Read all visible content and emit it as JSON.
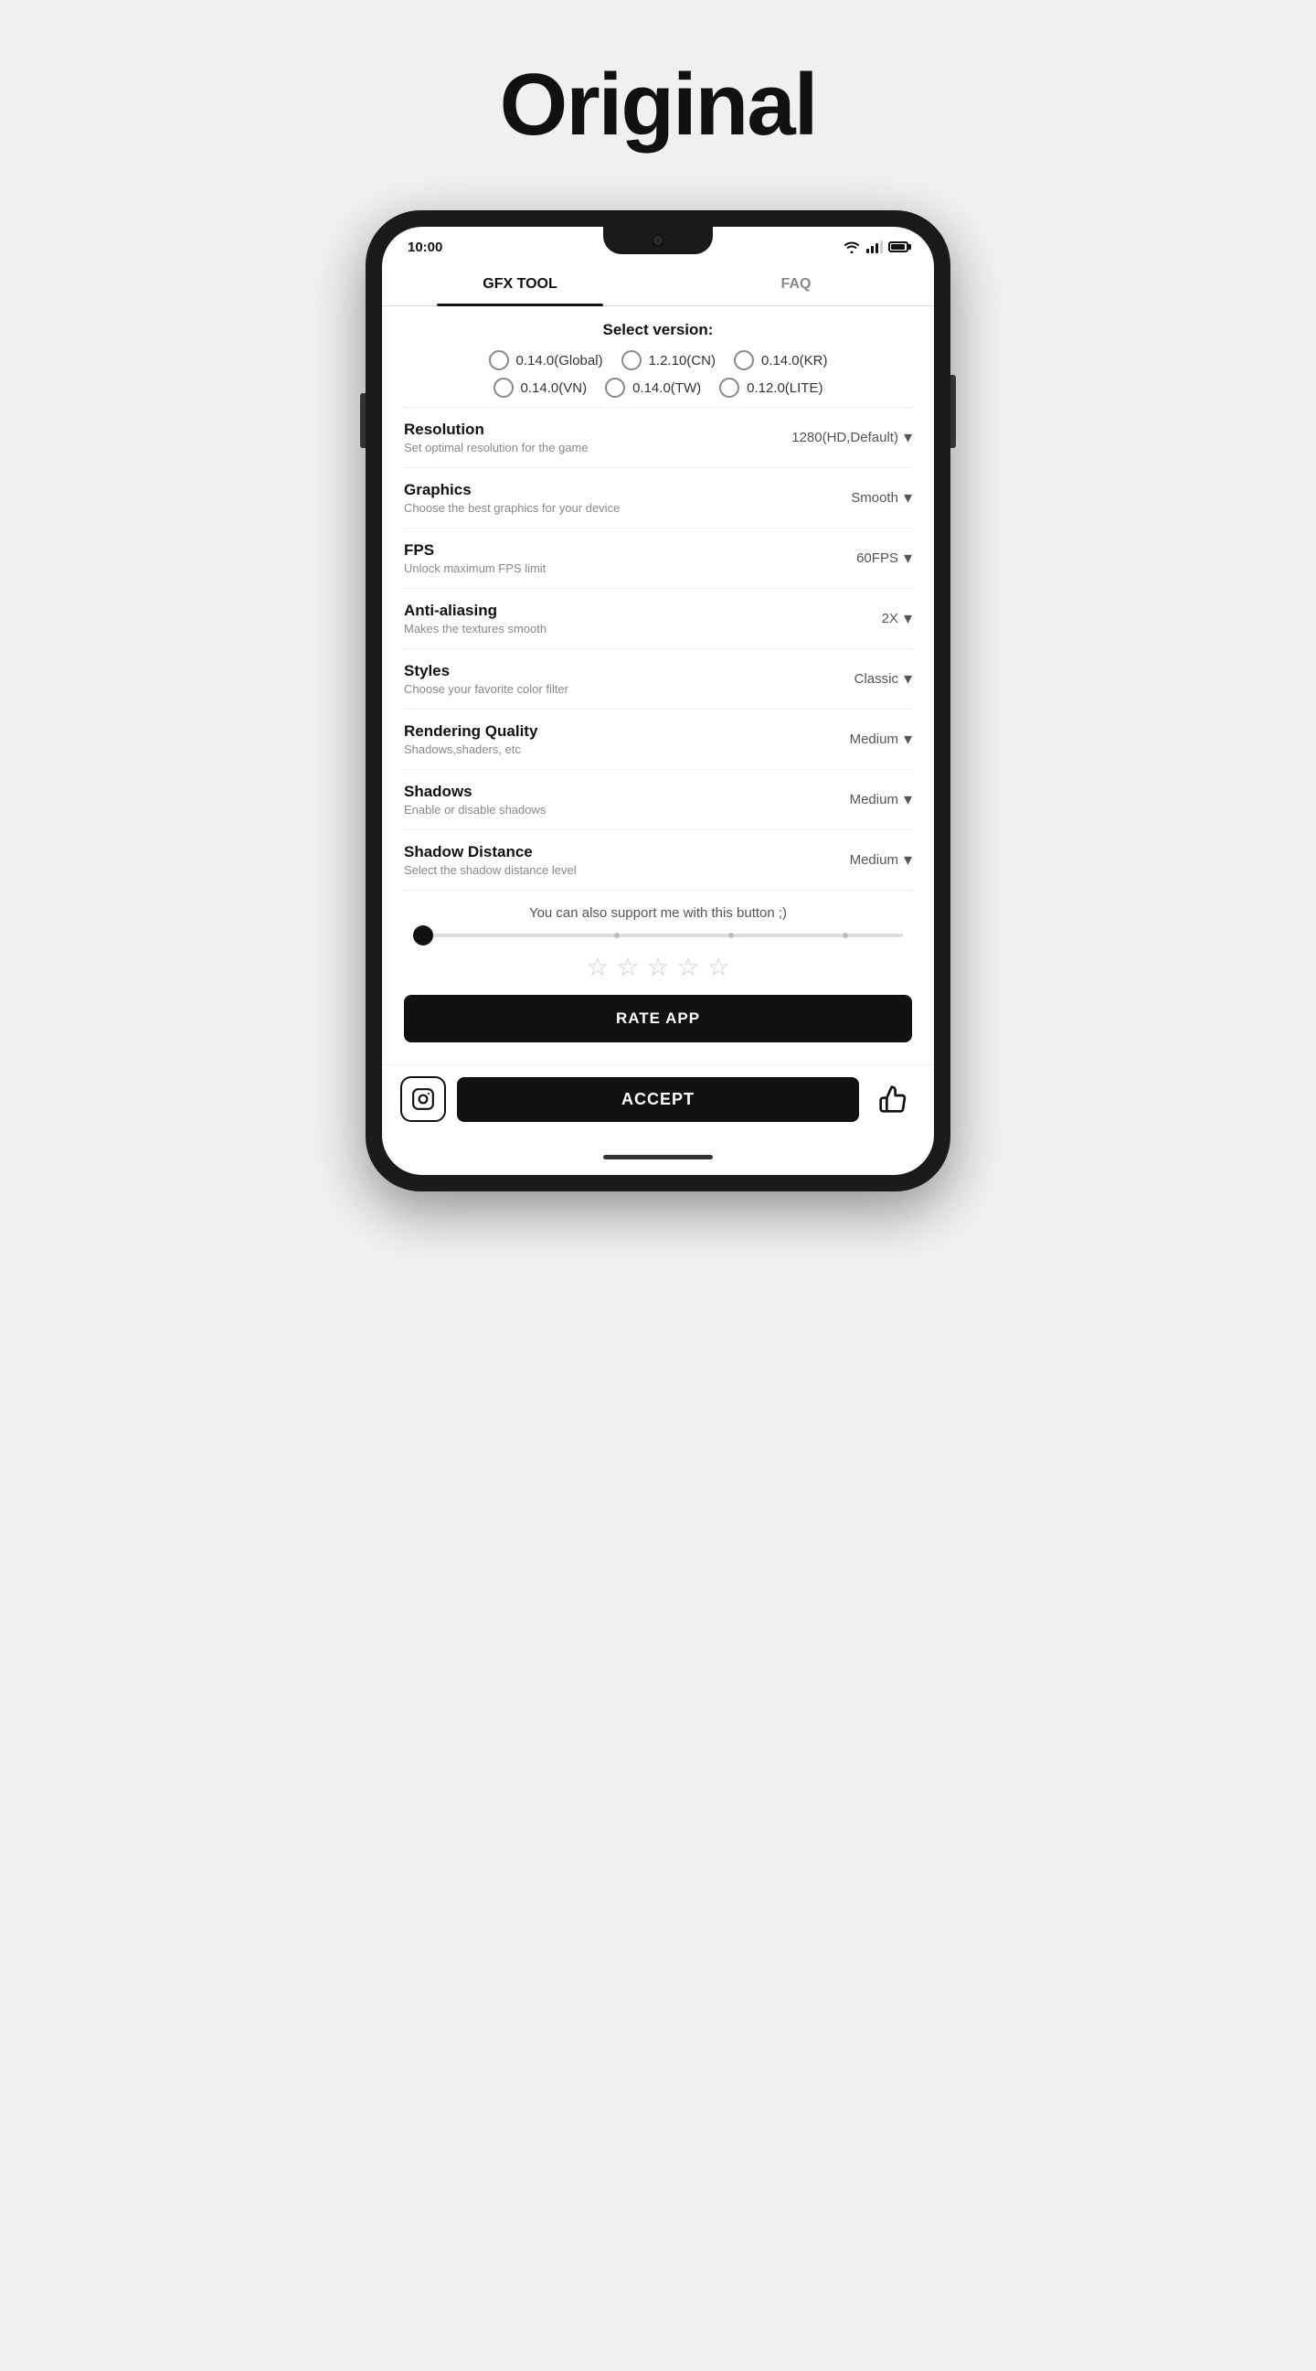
{
  "page": {
    "title": "Original"
  },
  "statusBar": {
    "time": "10:00"
  },
  "tabs": [
    {
      "id": "gfx-tool",
      "label": "GFX TOOL",
      "active": true
    },
    {
      "id": "faq",
      "label": "FAQ",
      "active": false
    }
  ],
  "versionSection": {
    "label": "Select version:",
    "options": [
      {
        "id": "global",
        "label": "0.14.0(Global)"
      },
      {
        "id": "cn",
        "label": "1.2.10(CN)"
      },
      {
        "id": "kr",
        "label": "0.14.0(KR)"
      },
      {
        "id": "vn",
        "label": "0.14.0(VN)"
      },
      {
        "id": "tw",
        "label": "0.14.0(TW)"
      },
      {
        "id": "lite",
        "label": "0.12.0(LITE)"
      }
    ]
  },
  "settings": [
    {
      "id": "resolution",
      "name": "Resolution",
      "desc": "Set optimal resolution for the game",
      "value": "1280(HD,Default)"
    },
    {
      "id": "graphics",
      "name": "Graphics",
      "desc": "Choose the best graphics for your device",
      "value": "Smooth"
    },
    {
      "id": "fps",
      "name": "FPS",
      "desc": "Unlock maximum FPS limit",
      "value": "60FPS"
    },
    {
      "id": "anti-aliasing",
      "name": "Anti-aliasing",
      "desc": "Makes the textures smooth",
      "value": "2X"
    },
    {
      "id": "styles",
      "name": "Styles",
      "desc": "Choose your favorite color filter",
      "value": "Classic"
    },
    {
      "id": "rendering-quality",
      "name": "Rendering Quality",
      "desc": "Shadows,shaders, etc",
      "value": "Medium"
    },
    {
      "id": "shadows",
      "name": "Shadows",
      "desc": "Enable or disable shadows",
      "value": "Medium"
    },
    {
      "id": "shadow-distance",
      "name": "Shadow Distance",
      "desc": "Select the shadow distance level",
      "value": "Medium"
    }
  ],
  "support": {
    "text": "You can also support me with this button ;)",
    "stars": [
      "☆",
      "☆",
      "☆",
      "☆",
      "☆"
    ],
    "rateLabel": "RATE APP"
  },
  "bottomBar": {
    "acceptLabel": "ACCEPT"
  }
}
